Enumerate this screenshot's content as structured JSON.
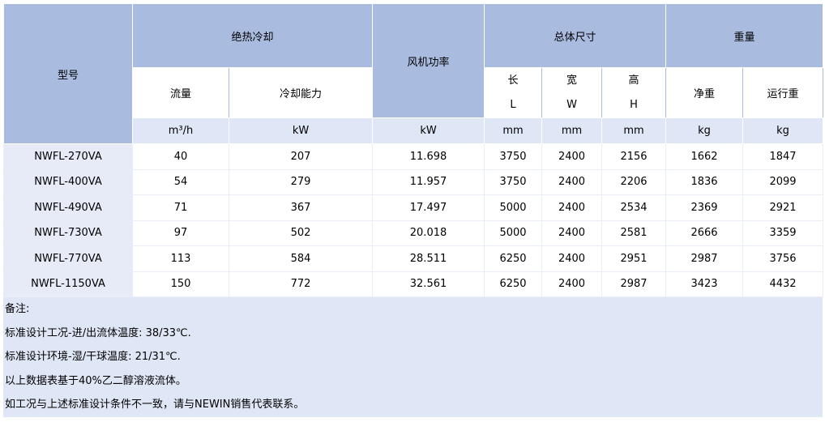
{
  "table": {
    "header": {
      "model": "型号",
      "cooling_group": "绝热冷却",
      "flow": "流量",
      "capacity": "冷却能力",
      "fan_power": "风机功率",
      "dimensions_group": "总体尺寸",
      "length": "长",
      "length_sym": "L",
      "width": "宽",
      "width_sym": "W",
      "height": "高",
      "height_sym": "H",
      "weight_group": "重量",
      "net_weight": "净重",
      "operating_weight": "运行重"
    },
    "units": [
      "m³/h",
      "kW",
      "kW",
      "mm",
      "mm",
      "mm",
      "kg",
      "kg"
    ],
    "rows": [
      {
        "model": "NWFL-270VA",
        "flow": "40",
        "capacity": "207",
        "fan": "11.698",
        "l": "3750",
        "w": "2400",
        "h": "2156",
        "net": "1662",
        "op": "1847"
      },
      {
        "model": "NWFL-400VA",
        "flow": "54",
        "capacity": "279",
        "fan": "11.957",
        "l": "3750",
        "w": "2400",
        "h": "2206",
        "net": "1836",
        "op": "2099"
      },
      {
        "model": "NWFL-490VA",
        "flow": "71",
        "capacity": "367",
        "fan": "17.497",
        "l": "5000",
        "w": "2400",
        "h": "2534",
        "net": "2369",
        "op": "2921"
      },
      {
        "model": "NWFL-730VA",
        "flow": "97",
        "capacity": "502",
        "fan": "20.018",
        "l": "5000",
        "w": "2400",
        "h": "2581",
        "net": "2666",
        "op": "3359"
      },
      {
        "model": "NWFL-770VA",
        "flow": "113",
        "capacity": "584",
        "fan": "28.511",
        "l": "6250",
        "w": "2400",
        "h": "2951",
        "net": "2987",
        "op": "3756"
      },
      {
        "model": "NWFL-1150VA",
        "flow": "150",
        "capacity": "772",
        "fan": "32.561",
        "l": "6250",
        "w": "2400",
        "h": "2987",
        "net": "3423",
        "op": "4432"
      }
    ]
  },
  "notes": [
    "备注:",
    "标准设计工况-进/出流体温度: 38/33℃.",
    "标准设计环境-湿/干球温度: 21/31℃.",
    "以上数据表基于40%乙二醇溶液流体。",
    "如工况与上述标准设计条件不一致，请与NEWIN销售代表联系。"
  ],
  "colors": {
    "header_blue": "#a9bcdf",
    "unit_row": "#dfe6f5",
    "model_cell": "#e6ebf7",
    "notes_bg": "#dfe6f5"
  }
}
